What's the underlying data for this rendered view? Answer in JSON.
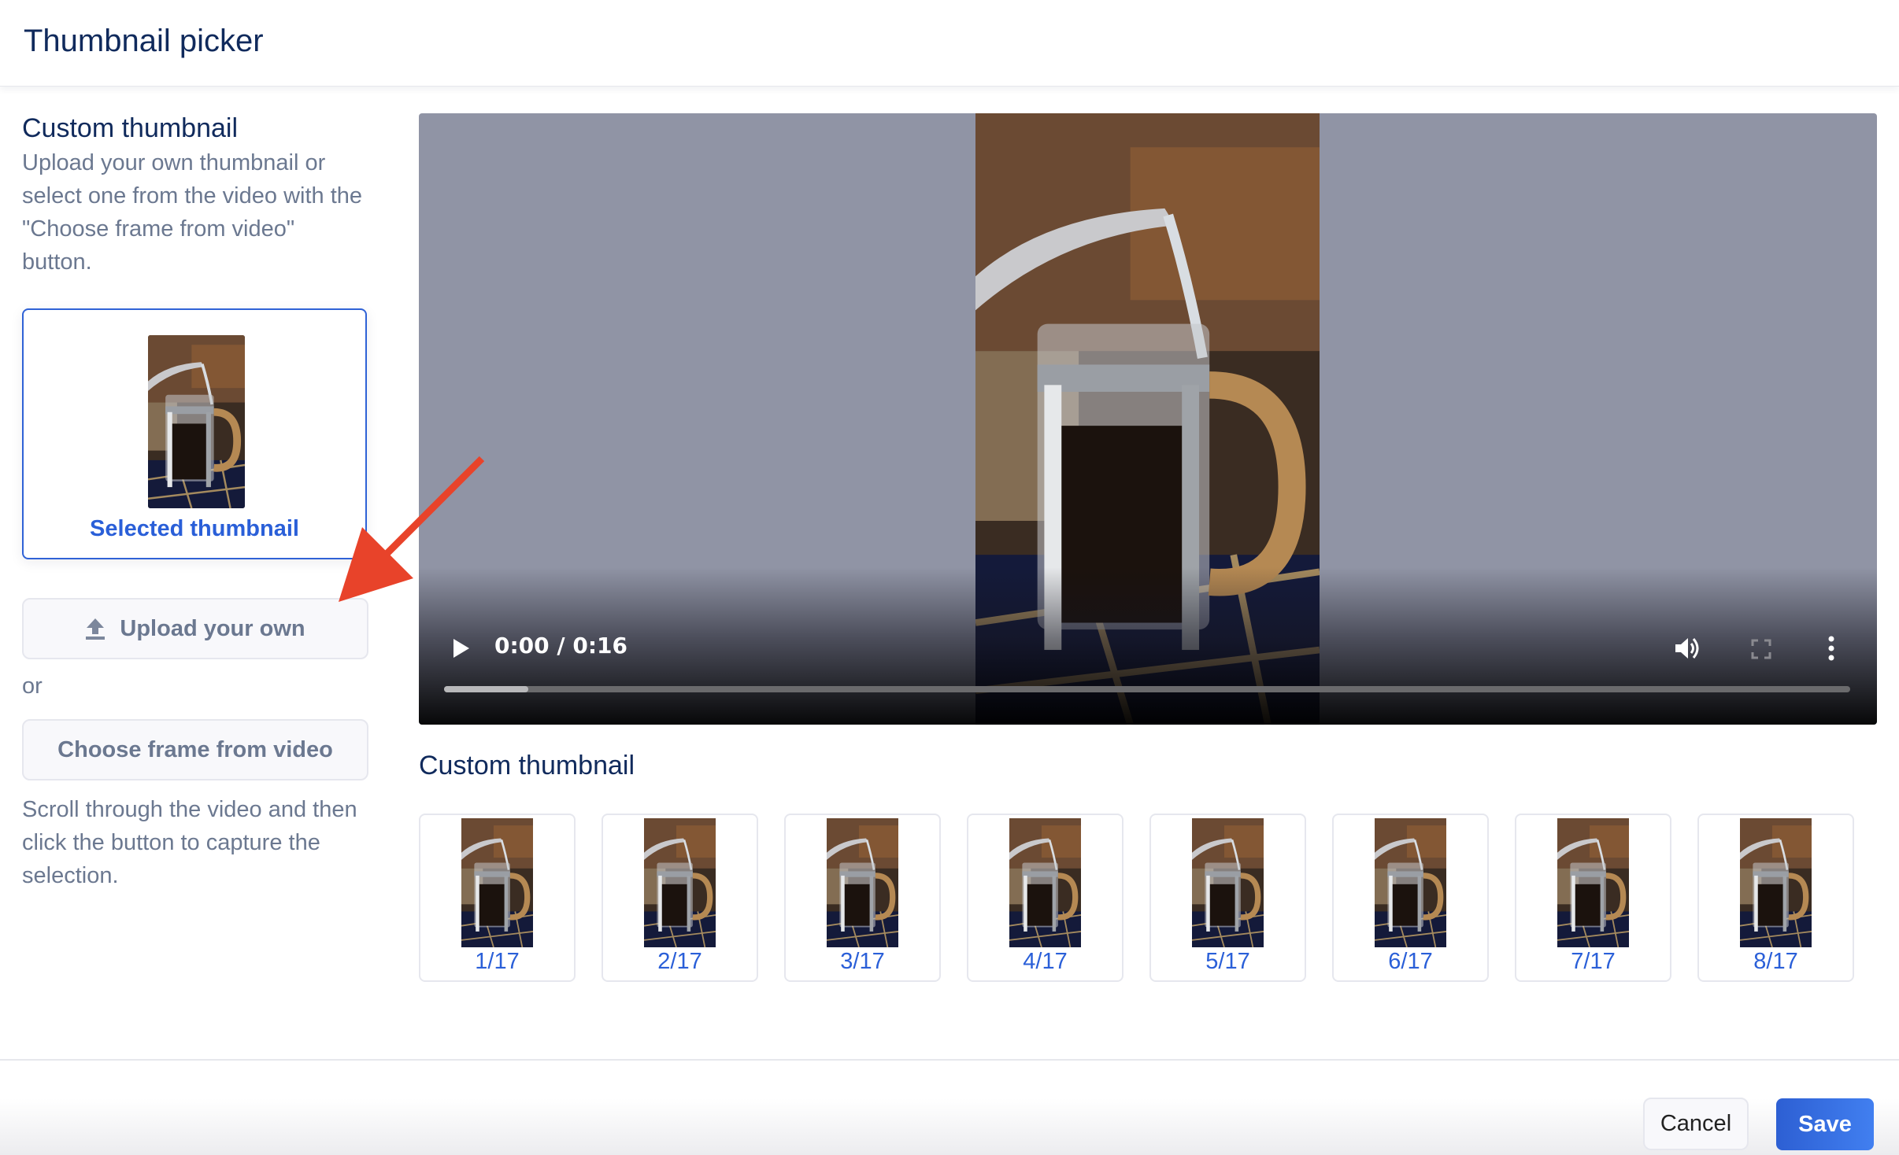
{
  "header": {
    "title": "Thumbnail picker"
  },
  "left": {
    "title": "Custom thumbnail",
    "description": "Upload your own thumbnail or select one from the video with the \"Choose frame from video\" button.",
    "selected_label": "Selected thumbnail",
    "upload_label": "Upload your own",
    "upload_icon": "upload-icon",
    "or_text": "or",
    "choose_label": "Choose frame from video",
    "help_text": "Scroll through the video and then click the button to capture the selection."
  },
  "video": {
    "time": "0:00 / 0:16",
    "progress_fraction": 0.06,
    "icons": [
      "play-icon",
      "volume-icon",
      "fullscreen-icon",
      "more-vert-icon"
    ]
  },
  "strip": {
    "title": "Custom thumbnail",
    "frames": [
      "1/17",
      "2/17",
      "3/17",
      "4/17",
      "5/17",
      "6/17",
      "7/17",
      "8/17"
    ]
  },
  "footer": {
    "cancel_label": "Cancel",
    "save_label": "Save"
  },
  "colors": {
    "accent": "#2f62d6",
    "title": "#102a5c",
    "muted": "#6b7890",
    "annotation_arrow": "#e8432a"
  }
}
